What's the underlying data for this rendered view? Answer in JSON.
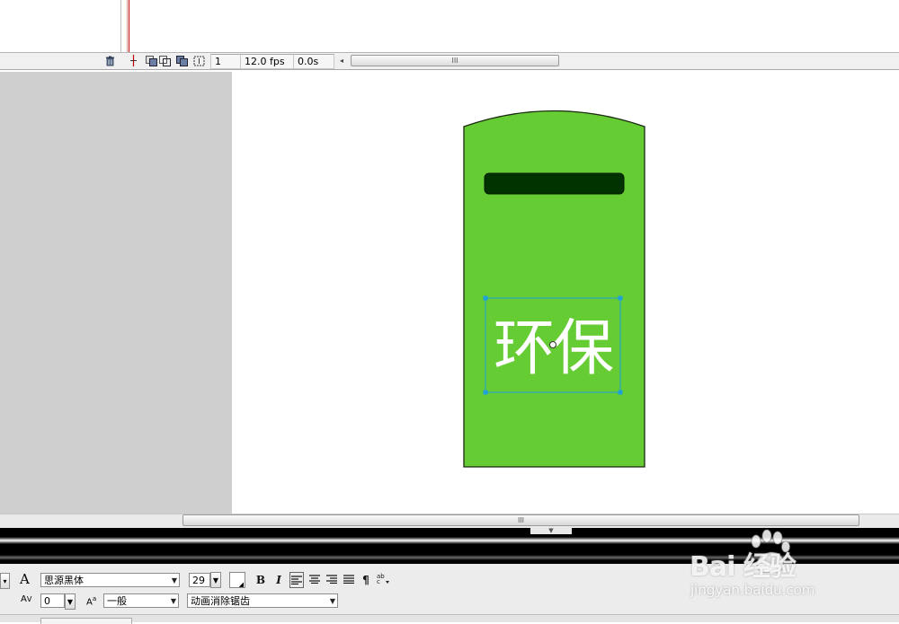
{
  "timeline": {
    "current_frame": "1",
    "frame_rate": "12.0 fps",
    "elapsed_time": "0.0s",
    "scroll_grip": "III"
  },
  "stage": {
    "mailbox_body_color": "#66cc33",
    "mailbox_slot_color": "#003300",
    "text": "环保",
    "text_color": "#ffffff",
    "selection_color": "#1ea0d8"
  },
  "properties": {
    "font_family": "思源黑体",
    "font_size": "29",
    "letter_spacing": "0",
    "baseline": "一般",
    "anti_alias": "动画消除锯齿",
    "bold_label": "B",
    "italic_label": "I"
  },
  "watermark": {
    "logo": "Bai   经验",
    "url": "jingyan.baidu.com"
  }
}
